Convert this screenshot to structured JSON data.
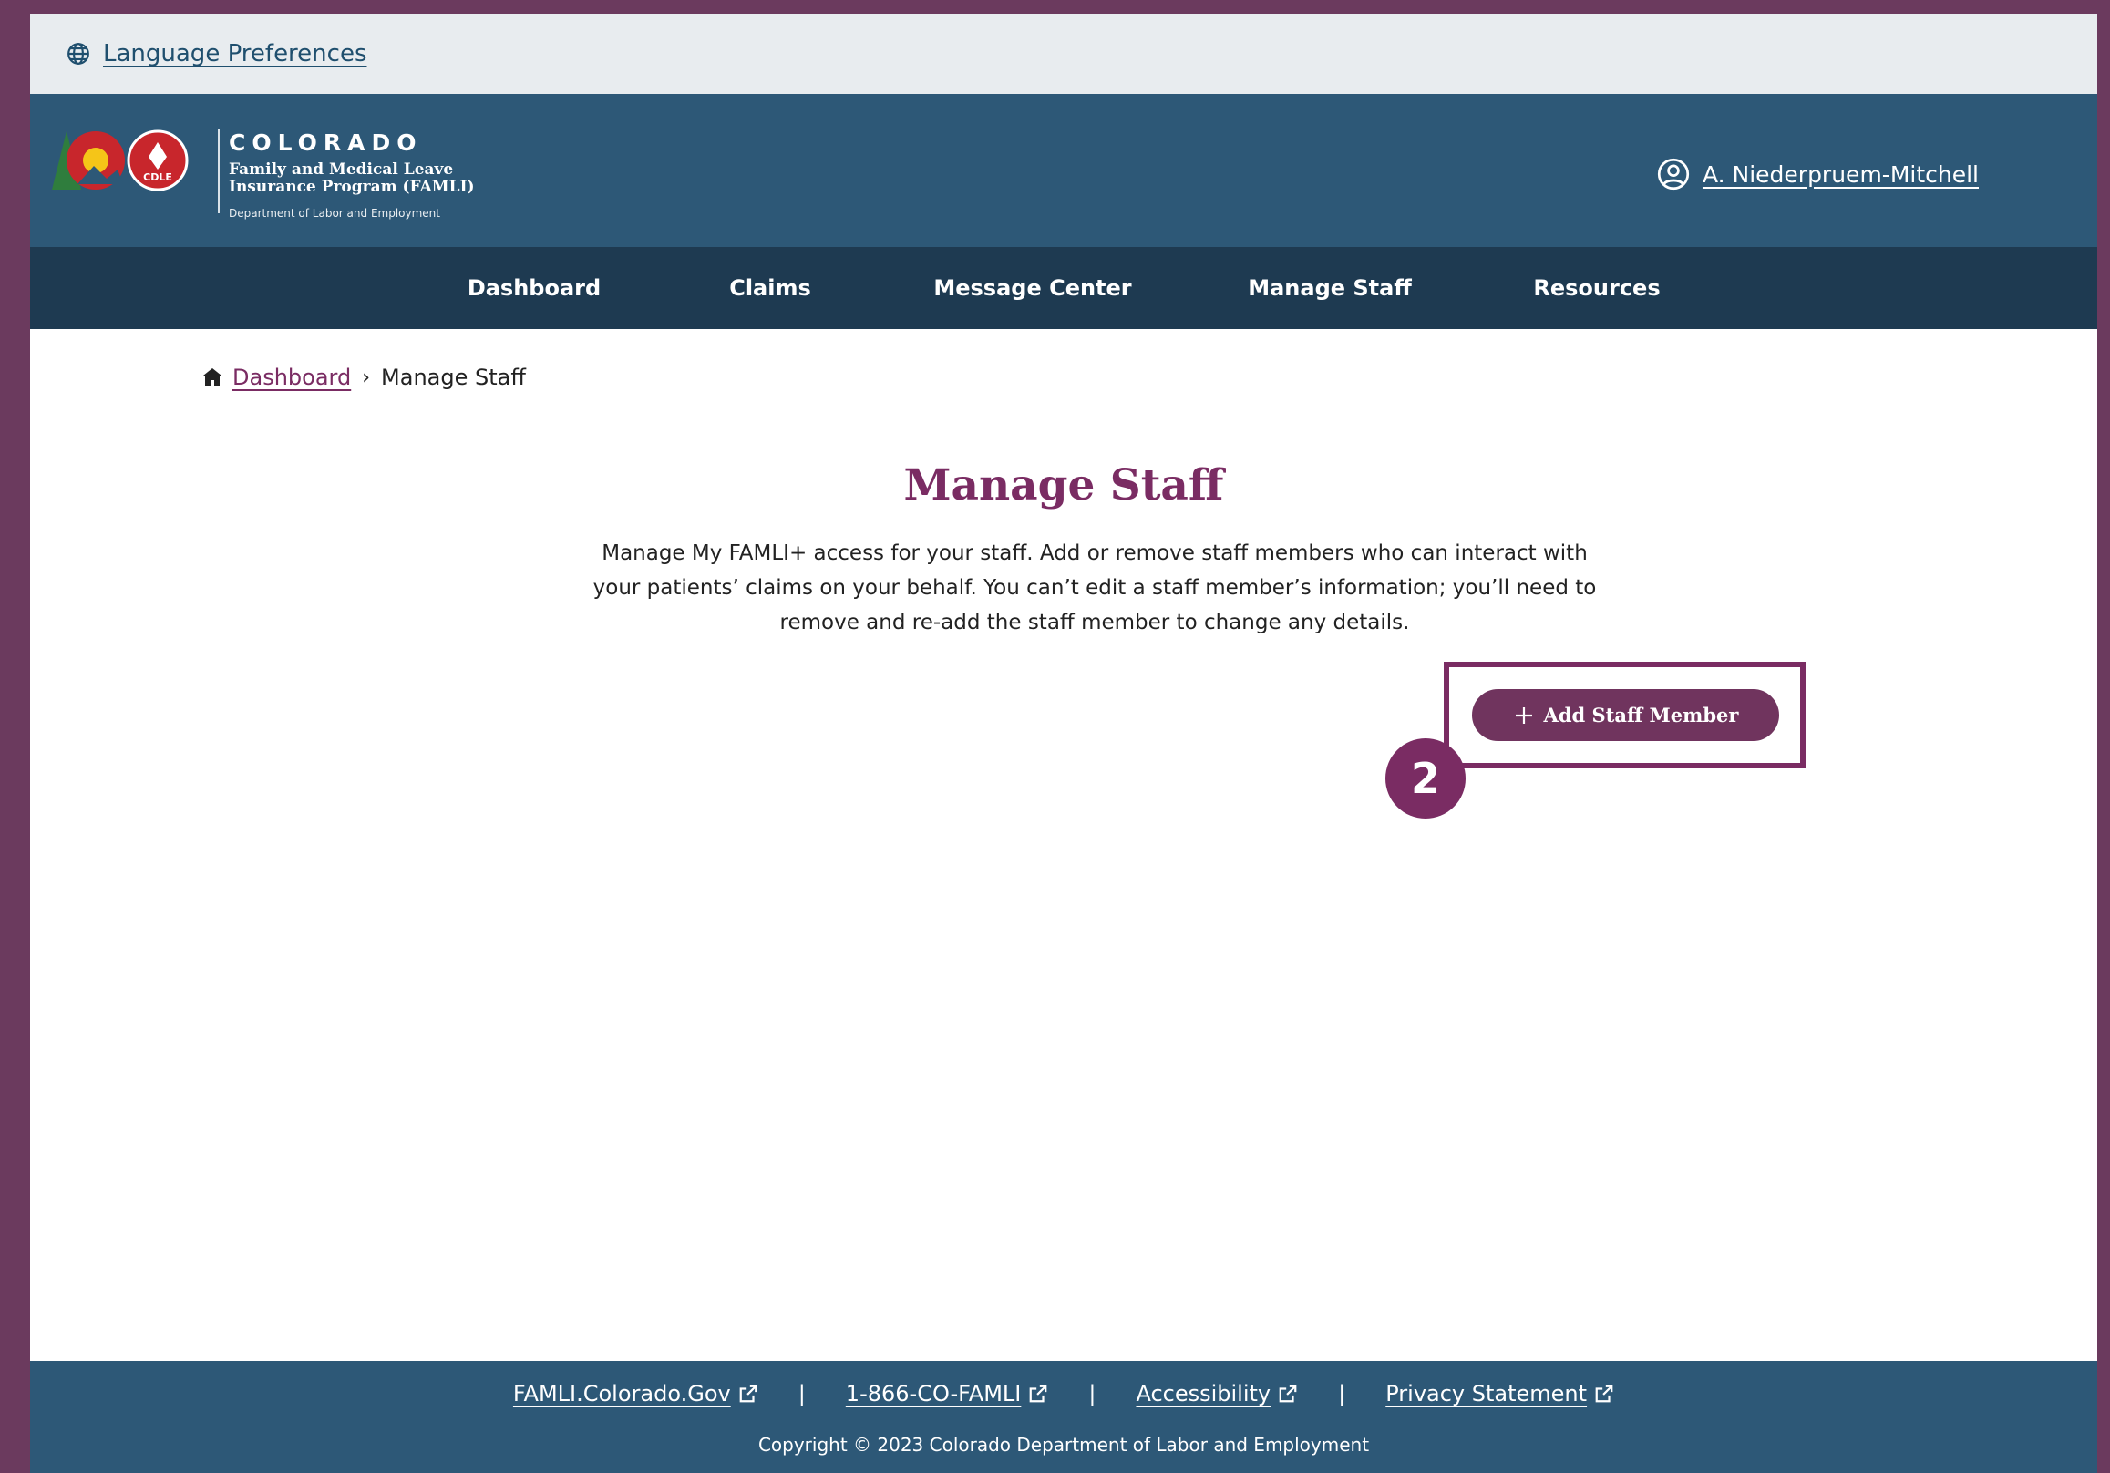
{
  "language_bar": {
    "link_label": "Language Preferences"
  },
  "header": {
    "logo_title": "COLORADO",
    "logo_subtitle_line1": "Family and Medical Leave",
    "logo_subtitle_line2": "Insurance Program (FAMLI)",
    "logo_dept": "Department of Labor and Employment",
    "logo_badge": "CDLE",
    "user_name": "A. Niederpruem-Mitchell"
  },
  "nav": {
    "items": [
      {
        "label": "Dashboard"
      },
      {
        "label": "Claims"
      },
      {
        "label": "Message Center"
      },
      {
        "label": "Manage Staff"
      },
      {
        "label": "Resources"
      }
    ]
  },
  "breadcrumb": {
    "home_label": "Dashboard",
    "current": "Manage Staff"
  },
  "main": {
    "title": "Manage Staff",
    "description": "Manage My FAMLI+ access for your staff. Add or remove staff members who can interact with your patients’ claims on your behalf. You can’t edit a staff member’s information; you’ll need to remove and re-add the staff member to change any details.",
    "add_button_label": "Add Staff Member",
    "step_number": "2"
  },
  "footer": {
    "links": [
      {
        "label": "FAMLI.Colorado.Gov"
      },
      {
        "label": "1-866-CO-FAMLI"
      },
      {
        "label": "Accessibility"
      },
      {
        "label": "Privacy Statement"
      }
    ],
    "separator": "|",
    "copyright": "Copyright © 2023 Colorado Department of Labor and Employment"
  },
  "colors": {
    "accent": "#7a2c63",
    "header_bg": "#2d5877",
    "nav_bg": "#1e3a51",
    "button_bg": "#70345e"
  }
}
